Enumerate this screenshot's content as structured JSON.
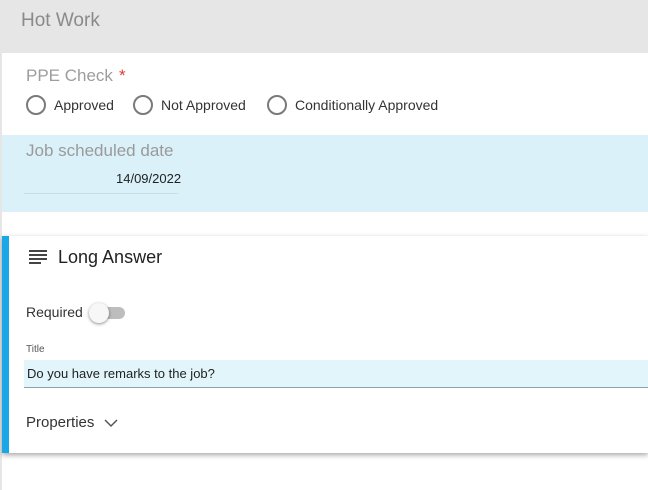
{
  "header": {
    "title": "Hot Work"
  },
  "ppe": {
    "label": "PPE Check",
    "required_mark": "*",
    "options": [
      "Approved",
      "Not Approved",
      "Conditionally Approved"
    ]
  },
  "date_field": {
    "label": "Job scheduled date",
    "value": "14/09/2022"
  },
  "card": {
    "icon": "subject-icon",
    "title": "Long Answer",
    "required_label": "Required",
    "required_on": false,
    "title_field_label": "Title",
    "title_field_value": "Do you have remarks to the job?",
    "properties_label": "Properties",
    "accent_color": "#1aa7e8"
  }
}
